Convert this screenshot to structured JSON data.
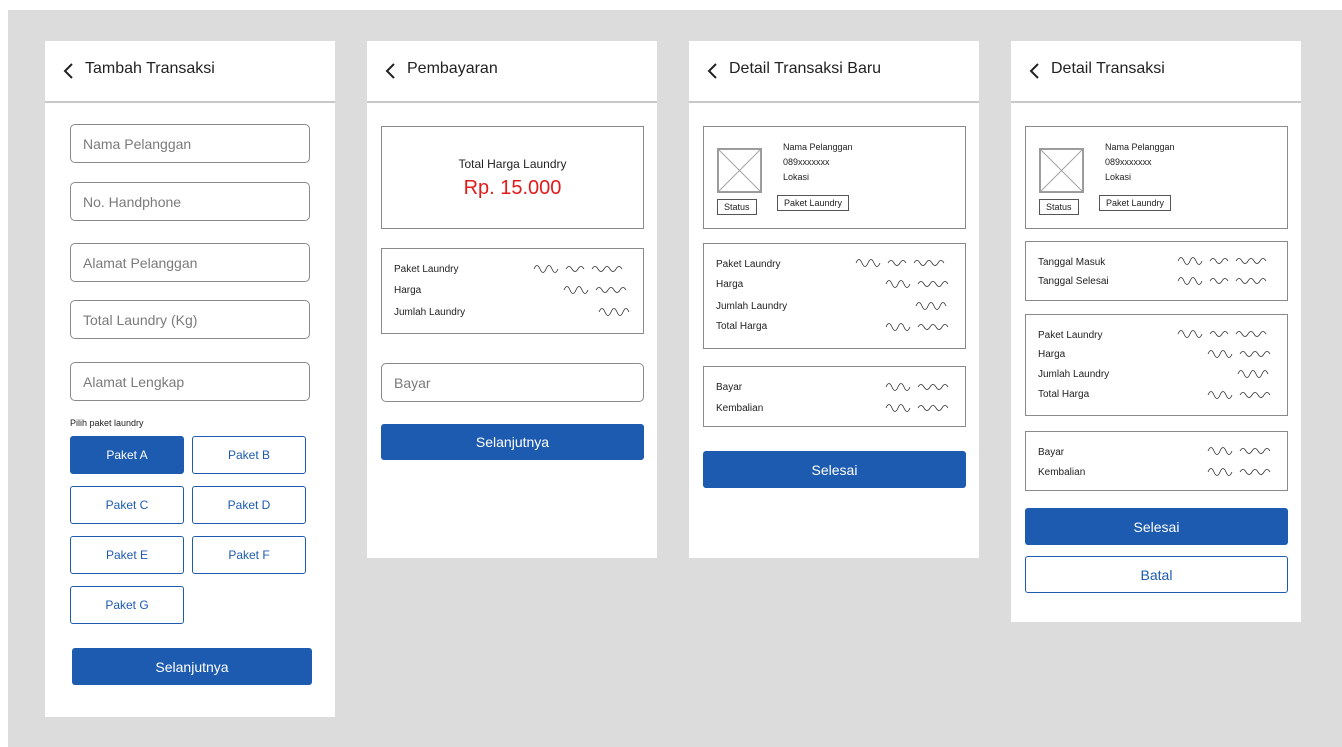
{
  "screens": [
    {
      "title": "Tambah Transaksi",
      "fields": [
        "Nama Pelanggan",
        "No. Handphone",
        "Alamat Pelanggan",
        "Total Laundry (Kg)",
        "Alamat Lengkap"
      ],
      "package_prompt": "Pilih paket laundry",
      "packages": [
        "Paket A",
        "Paket B",
        "Paket C",
        "Paket D",
        "Paket E",
        "Paket F",
        "Paket G"
      ],
      "selected_package": "Paket A",
      "next_button": "Selanjutnya"
    },
    {
      "title": "Pembayaran",
      "total_label": "Total Harga Laundry",
      "total_amount": "Rp. 15.000",
      "rows": [
        "Paket Laundry",
        "Harga",
        "Jumlah Laundry"
      ],
      "pay_placeholder": "Bayar",
      "next_button": "Selanjutnya"
    },
    {
      "title": "Detail Transaksi Baru",
      "customer": {
        "name": "Nama Pelanggan",
        "phone": "089xxxxxxx",
        "location": "Lokasi"
      },
      "status": "Status",
      "package": "Paket Laundry",
      "rows": [
        "Paket Laundry",
        "Harga",
        "Jumlah Laundry",
        "Total Harga"
      ],
      "payment_rows": [
        "Bayar",
        "Kembalian"
      ],
      "done_button": "Selesai"
    },
    {
      "title": "Detail Transaksi",
      "customer": {
        "name": "Nama Pelanggan",
        "phone": "089xxxxxxx",
        "location": "Lokasi"
      },
      "status": "Status",
      "package": "Paket Laundry",
      "date_rows": [
        "Tanggal Masuk",
        "Tanggal Selesai"
      ],
      "rows": [
        "Paket Laundry",
        "Harga",
        "Jumlah Laundry",
        "Total Harga"
      ],
      "payment_rows": [
        "Bayar",
        "Kembalian"
      ],
      "done_button": "Selesai",
      "cancel_button": "Batal"
    }
  ],
  "colors": {
    "primary": "#1d5bb0",
    "price": "#e21b1b",
    "background": "#dcdcdc"
  },
  "icons": {
    "back": "chevron-left-icon",
    "image_placeholder": "image-placeholder-icon",
    "scribble": "placeholder-text-scribble"
  }
}
